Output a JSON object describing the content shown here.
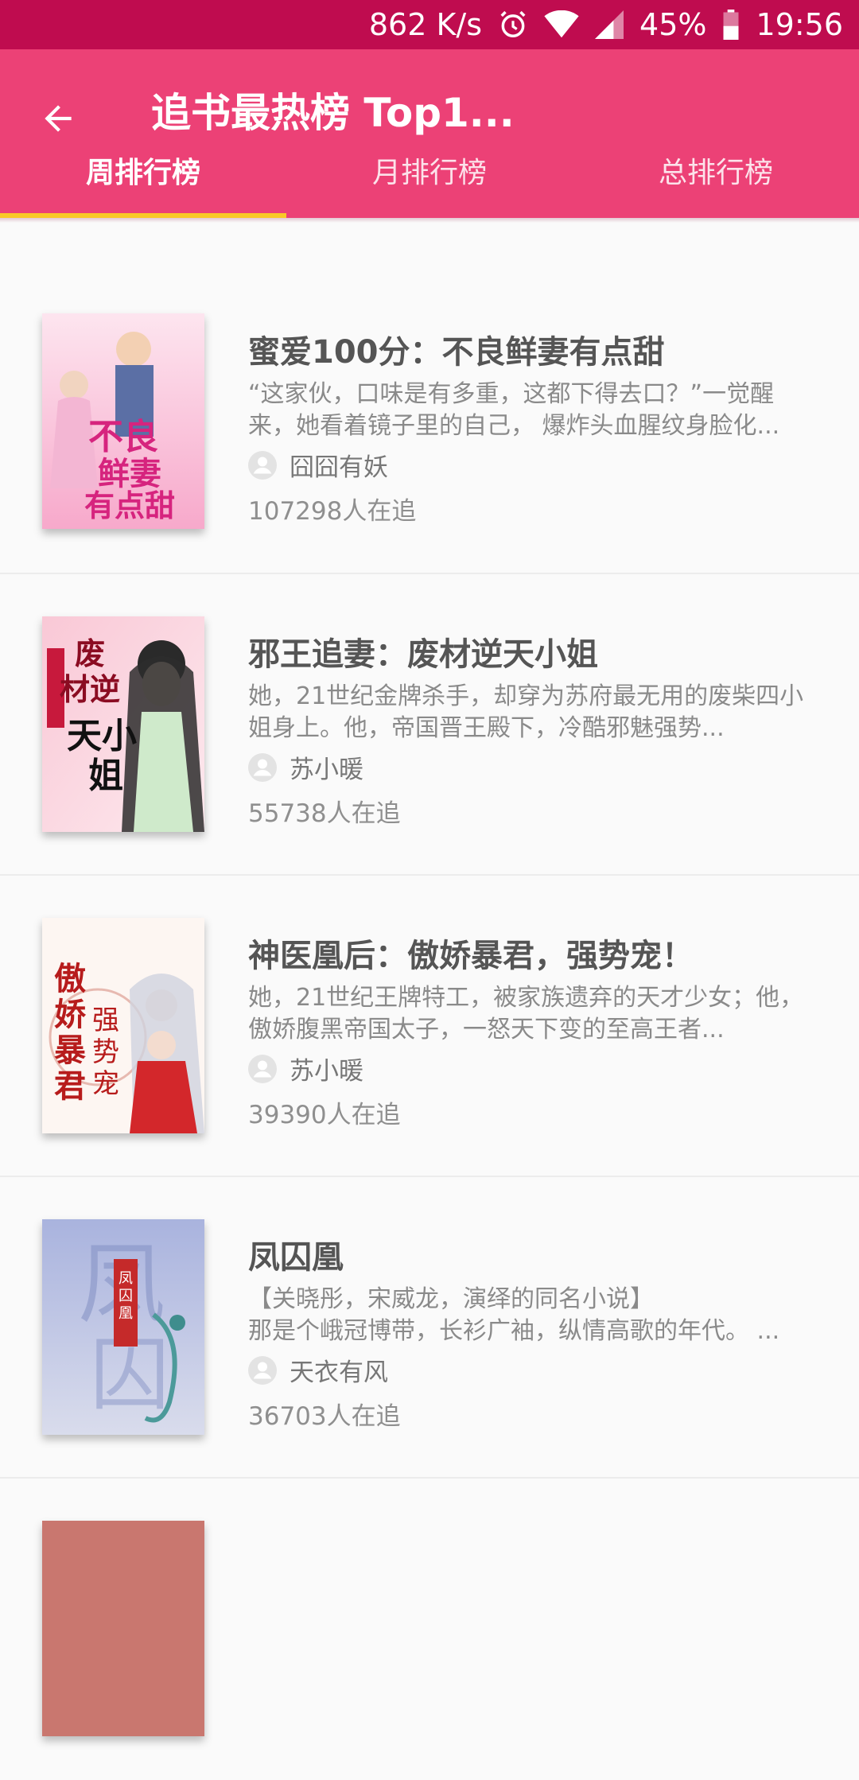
{
  "status_bar": {
    "speed": "862 K/s",
    "battery": "45%",
    "time": "19:56",
    "bg_color": "#bf0c4f"
  },
  "app_bar": {
    "title": "追书最热榜 Top1...",
    "back_icon": "arrow-left-icon",
    "bg_color": "#ec4176"
  },
  "tabs": [
    {
      "label": "周排行榜",
      "active": true
    },
    {
      "label": "月排行榜",
      "active": false
    },
    {
      "label": "总排行榜",
      "active": false
    }
  ],
  "tab_indicator_color": "#f9c928",
  "books": [
    {
      "title": "蜜爱100分：不良鲜妻有点甜",
      "desc": "“这家伙，口味是有多重，这都下得去口？”一觉醒来，她看着镜子里的自己， 爆炸头血腥纹身脸化...",
      "author": "囧囧有妖",
      "followers": "107298人在追",
      "cover_text": "不良鲜妻有点甜",
      "cover_colors": [
        "#f7b6d2",
        "#e8509a"
      ]
    },
    {
      "title": "邪王追妻：废材逆天小姐",
      "desc": "她，21世纪金牌杀手，却穿为苏府最无用的废柴四小姐身上。他，帝国晋王殿下，冷酷邪魅强势...",
      "author": "苏小暖",
      "followers": "55738人在追",
      "cover_text": "废材逆天小姐",
      "cover_colors": [
        "#fbd5de",
        "#e9879e"
      ]
    },
    {
      "title": "神医凰后：傲娇暴君，强势宠！",
      "desc": "她，21世纪王牌特工，被家族遗弃的天才少女；他，傲娇腹黑帝国太子，一怒天下变的至高王者...",
      "author": "苏小暖",
      "followers": "39390人在追",
      "cover_text": "傲娇暴君强势宠",
      "cover_colors": [
        "#fdf3ef",
        "#d32a2a"
      ]
    },
    {
      "title": "凤囚凰",
      "desc": "【关晓彤，宋威龙，演绎的同名小说】\n那是个峨冠博带，长衫广袖，纵情高歌的年代。 ...",
      "author": "天衣有风",
      "followers": "36703人在追",
      "cover_text": "凤囚凰",
      "cover_colors": [
        "#b9c2e3",
        "#6f7fbf"
      ]
    }
  ]
}
